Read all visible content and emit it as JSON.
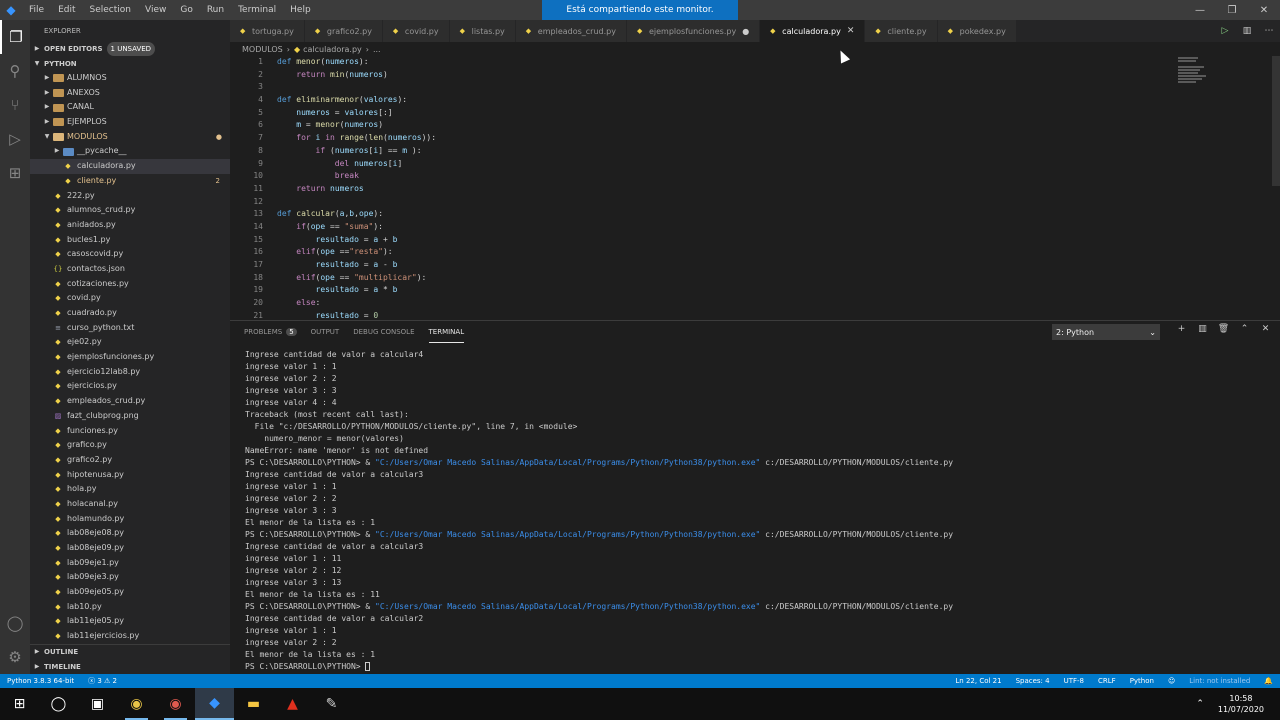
{
  "titlebar": {
    "menus": [
      "File",
      "Edit",
      "Selection",
      "View",
      "Go",
      "Run",
      "Terminal",
      "Help"
    ],
    "share_banner": "Está compartiendo este monitor.",
    "controls": [
      "—",
      "❐",
      "✕"
    ]
  },
  "activitybar": {
    "icons": [
      "explorer-icon",
      "search-icon",
      "source-control-icon",
      "run-debug-icon",
      "extensions-icon",
      "accounts-icon",
      "settings-gear-icon"
    ]
  },
  "sidebar": {
    "header": "EXPLORER",
    "open_editors": {
      "label": "OPEN EDITORS",
      "badge": "1 UNSAVED"
    },
    "workspace": "PYTHON",
    "folders_top": [
      "ALUMNOS",
      "ANEXOS",
      "CANAL",
      "EJEMPLOS"
    ],
    "modulos": "MODULOS",
    "modulos_children": [
      "__pycache__",
      "calculadora.py",
      "cliente.py"
    ],
    "cliente_problems": "2",
    "files": [
      "222.py",
      "alumnos_crud.py",
      "anidados.py",
      "bucles1.py",
      "casoscovid.py",
      "contactos.json",
      "cotizaciones.py",
      "covid.py",
      "cuadrado.py",
      "curso_python.txt",
      "eje02.py",
      "ejemplosfunciones.py",
      "ejercicio12lab8.py",
      "ejercicios.py",
      "empleados_crud.py",
      "fazt_clubprog.png",
      "funciones.py",
      "grafico.py",
      "grafico2.py",
      "hipotenusa.py",
      "hola.py",
      "holacanal.py",
      "holamundo.py",
      "lab08eje08.py",
      "lab08eje09.py",
      "lab09eje1.py",
      "lab09eje3.py",
      "lab09eje05.py",
      "lab10.py",
      "lab11eje05.py",
      "lab11ejercicios.py"
    ],
    "outline": "OUTLINE",
    "timeline": "TIMELINE"
  },
  "tabs": [
    {
      "label": "tortuga.py"
    },
    {
      "label": "grafico2.py"
    },
    {
      "label": "covid.py"
    },
    {
      "label": "listas.py"
    },
    {
      "label": "empleados_crud.py"
    },
    {
      "label": "ejemplosfunciones.py"
    },
    {
      "label": "calculadora.py"
    },
    {
      "label": "cliente.py"
    },
    {
      "label": "pokedex.py"
    }
  ],
  "breadcrumb": {
    "folder": "MODULOS",
    "file": "calculadora.py",
    "tail": "..."
  },
  "editor": {
    "line_numbers": [
      "1",
      "2",
      "3",
      "4",
      "5",
      "6",
      "7",
      "8",
      "9",
      "10",
      "11",
      "12",
      "13",
      "14",
      "15",
      "16",
      "17",
      "18",
      "19",
      "20",
      "21"
    ]
  },
  "panel": {
    "tabs": {
      "problems": "PROBLEMS",
      "problems_count": "5",
      "output": "OUTPUT",
      "debug": "DEBUG CONSOLE",
      "terminal": "TERMINAL"
    },
    "terminal_select": "2: Python",
    "terminal_lines": [
      "Ingrese cantidad de valor a calcular4",
      "ingrese valor 1 : 1",
      "ingrese valor 2 : 2",
      "ingrese valor 3 : 3",
      "ingrese valor 4 : 4",
      "Traceback (most recent call last):",
      "  File \"c:/DESARROLLO/PYTHON/MODULOS/cliente.py\", line 7, in <module>",
      "    numero_menor = menor(valores)",
      "NameError: name 'menor' is not defined",
      "ps1",
      "Ingrese cantidad de valor a calcular3",
      "ingrese valor 1 : 1",
      "ingrese valor 2 : 2",
      "ingrese valor 3 : 3",
      "El menor de la lista es : 1",
      "ps1",
      "Ingrese cantidad de valor a calcular3",
      "ingrese valor 1 : 11",
      "ingrese valor 2 : 12",
      "ingrese valor 3 : 13",
      "El menor de la lista es : 11",
      "ps1",
      "Ingrese cantidad de valor a calcular2",
      "ingrese valor 1 : 1",
      "ingrese valor 2 : 2",
      "El menor de la lista es : 1",
      "ps2"
    ],
    "ps_prompt": "PS C:\\DESARROLLO\\PYTHON> & ",
    "ps_exe": "\"C:/Users/Omar Macedo Salinas/AppData/Local/Programs/Python/Python38/python.exe\"",
    "ps_script": " c:/DESARROLLO/PYTHON/MODULOS/cliente.py",
    "ps_final": "PS C:\\DESARROLLO\\PYTHON> "
  },
  "statusbar": {
    "interpreter": "Python 3.8.3 64-bit",
    "errors": "ⓧ 3",
    "warnings": "⚠ 2",
    "position": "Ln 22, Col 21",
    "spaces": "Spaces: 4",
    "encoding": "UTF-8",
    "eol": "CRLF",
    "language": "Python",
    "lint": "Lint: not installed"
  },
  "taskbar": {
    "time": "10:58",
    "date": "11/07/2020"
  }
}
